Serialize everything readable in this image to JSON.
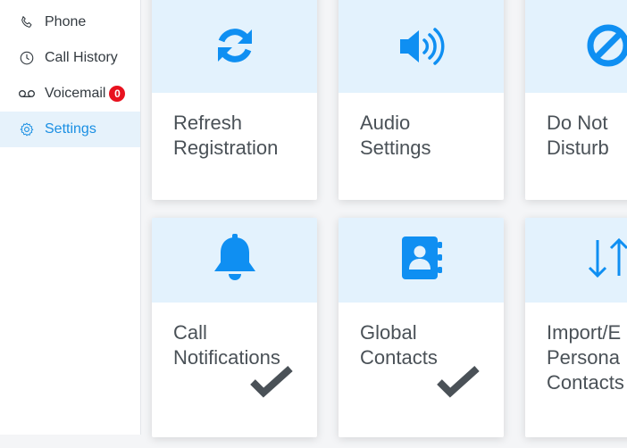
{
  "sidebar": {
    "items": [
      {
        "label": "Phone",
        "icon": "phone-icon"
      },
      {
        "label": "Call History",
        "icon": "clock-icon"
      },
      {
        "label": "Voicemail",
        "icon": "voicemail-icon",
        "badge": "0"
      },
      {
        "label": "Settings",
        "icon": "gear-icon",
        "active": true
      }
    ]
  },
  "tiles": [
    {
      "label": "Refresh\nRegistration",
      "icon": "refresh-icon"
    },
    {
      "label": "Audio\nSettings",
      "icon": "speaker-icon"
    },
    {
      "label": "Do Not\nDisturb",
      "icon": "block-icon"
    },
    {
      "label": "Call\nNotifications",
      "icon": "bell-icon",
      "checked": true
    },
    {
      "label": "Global\nContacts",
      "icon": "contacts-book-icon",
      "checked": true
    },
    {
      "label": "Import/E\nPersona\nContacts",
      "icon": "transfer-arrows-icon"
    }
  ],
  "colors": {
    "accent": "#1a8fe3",
    "icon_blue": "#0f8ff2",
    "tile_top": "#e3f2fd",
    "badge": "#e8121f",
    "check": "#4a5157"
  }
}
